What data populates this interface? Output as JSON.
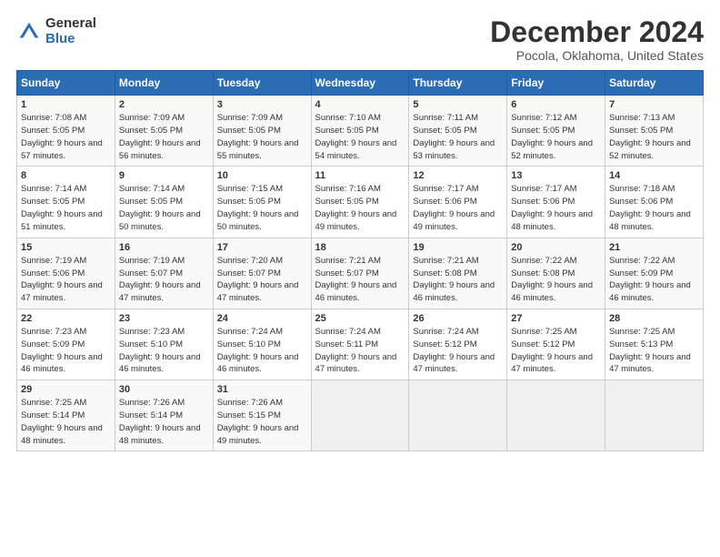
{
  "header": {
    "logo_general": "General",
    "logo_blue": "Blue",
    "title": "December 2024",
    "subtitle": "Pocola, Oklahoma, United States"
  },
  "days_of_week": [
    "Sunday",
    "Monday",
    "Tuesday",
    "Wednesday",
    "Thursday",
    "Friday",
    "Saturday"
  ],
  "weeks": [
    [
      {
        "day": "1",
        "sunrise": "Sunrise: 7:08 AM",
        "sunset": "Sunset: 5:05 PM",
        "daylight": "Daylight: 9 hours and 57 minutes."
      },
      {
        "day": "2",
        "sunrise": "Sunrise: 7:09 AM",
        "sunset": "Sunset: 5:05 PM",
        "daylight": "Daylight: 9 hours and 56 minutes."
      },
      {
        "day": "3",
        "sunrise": "Sunrise: 7:09 AM",
        "sunset": "Sunset: 5:05 PM",
        "daylight": "Daylight: 9 hours and 55 minutes."
      },
      {
        "day": "4",
        "sunrise": "Sunrise: 7:10 AM",
        "sunset": "Sunset: 5:05 PM",
        "daylight": "Daylight: 9 hours and 54 minutes."
      },
      {
        "day": "5",
        "sunrise": "Sunrise: 7:11 AM",
        "sunset": "Sunset: 5:05 PM",
        "daylight": "Daylight: 9 hours and 53 minutes."
      },
      {
        "day": "6",
        "sunrise": "Sunrise: 7:12 AM",
        "sunset": "Sunset: 5:05 PM",
        "daylight": "Daylight: 9 hours and 52 minutes."
      },
      {
        "day": "7",
        "sunrise": "Sunrise: 7:13 AM",
        "sunset": "Sunset: 5:05 PM",
        "daylight": "Daylight: 9 hours and 52 minutes."
      }
    ],
    [
      {
        "day": "8",
        "sunrise": "Sunrise: 7:14 AM",
        "sunset": "Sunset: 5:05 PM",
        "daylight": "Daylight: 9 hours and 51 minutes."
      },
      {
        "day": "9",
        "sunrise": "Sunrise: 7:14 AM",
        "sunset": "Sunset: 5:05 PM",
        "daylight": "Daylight: 9 hours and 50 minutes."
      },
      {
        "day": "10",
        "sunrise": "Sunrise: 7:15 AM",
        "sunset": "Sunset: 5:05 PM",
        "daylight": "Daylight: 9 hours and 50 minutes."
      },
      {
        "day": "11",
        "sunrise": "Sunrise: 7:16 AM",
        "sunset": "Sunset: 5:05 PM",
        "daylight": "Daylight: 9 hours and 49 minutes."
      },
      {
        "day": "12",
        "sunrise": "Sunrise: 7:17 AM",
        "sunset": "Sunset: 5:06 PM",
        "daylight": "Daylight: 9 hours and 49 minutes."
      },
      {
        "day": "13",
        "sunrise": "Sunrise: 7:17 AM",
        "sunset": "Sunset: 5:06 PM",
        "daylight": "Daylight: 9 hours and 48 minutes."
      },
      {
        "day": "14",
        "sunrise": "Sunrise: 7:18 AM",
        "sunset": "Sunset: 5:06 PM",
        "daylight": "Daylight: 9 hours and 48 minutes."
      }
    ],
    [
      {
        "day": "15",
        "sunrise": "Sunrise: 7:19 AM",
        "sunset": "Sunset: 5:06 PM",
        "daylight": "Daylight: 9 hours and 47 minutes."
      },
      {
        "day": "16",
        "sunrise": "Sunrise: 7:19 AM",
        "sunset": "Sunset: 5:07 PM",
        "daylight": "Daylight: 9 hours and 47 minutes."
      },
      {
        "day": "17",
        "sunrise": "Sunrise: 7:20 AM",
        "sunset": "Sunset: 5:07 PM",
        "daylight": "Daylight: 9 hours and 47 minutes."
      },
      {
        "day": "18",
        "sunrise": "Sunrise: 7:21 AM",
        "sunset": "Sunset: 5:07 PM",
        "daylight": "Daylight: 9 hours and 46 minutes."
      },
      {
        "day": "19",
        "sunrise": "Sunrise: 7:21 AM",
        "sunset": "Sunset: 5:08 PM",
        "daylight": "Daylight: 9 hours and 46 minutes."
      },
      {
        "day": "20",
        "sunrise": "Sunrise: 7:22 AM",
        "sunset": "Sunset: 5:08 PM",
        "daylight": "Daylight: 9 hours and 46 minutes."
      },
      {
        "day": "21",
        "sunrise": "Sunrise: 7:22 AM",
        "sunset": "Sunset: 5:09 PM",
        "daylight": "Daylight: 9 hours and 46 minutes."
      }
    ],
    [
      {
        "day": "22",
        "sunrise": "Sunrise: 7:23 AM",
        "sunset": "Sunset: 5:09 PM",
        "daylight": "Daylight: 9 hours and 46 minutes."
      },
      {
        "day": "23",
        "sunrise": "Sunrise: 7:23 AM",
        "sunset": "Sunset: 5:10 PM",
        "daylight": "Daylight: 9 hours and 46 minutes."
      },
      {
        "day": "24",
        "sunrise": "Sunrise: 7:24 AM",
        "sunset": "Sunset: 5:10 PM",
        "daylight": "Daylight: 9 hours and 46 minutes."
      },
      {
        "day": "25",
        "sunrise": "Sunrise: 7:24 AM",
        "sunset": "Sunset: 5:11 PM",
        "daylight": "Daylight: 9 hours and 47 minutes."
      },
      {
        "day": "26",
        "sunrise": "Sunrise: 7:24 AM",
        "sunset": "Sunset: 5:12 PM",
        "daylight": "Daylight: 9 hours and 47 minutes."
      },
      {
        "day": "27",
        "sunrise": "Sunrise: 7:25 AM",
        "sunset": "Sunset: 5:12 PM",
        "daylight": "Daylight: 9 hours and 47 minutes."
      },
      {
        "day": "28",
        "sunrise": "Sunrise: 7:25 AM",
        "sunset": "Sunset: 5:13 PM",
        "daylight": "Daylight: 9 hours and 47 minutes."
      }
    ],
    [
      {
        "day": "29",
        "sunrise": "Sunrise: 7:25 AM",
        "sunset": "Sunset: 5:14 PM",
        "daylight": "Daylight: 9 hours and 48 minutes."
      },
      {
        "day": "30",
        "sunrise": "Sunrise: 7:26 AM",
        "sunset": "Sunset: 5:14 PM",
        "daylight": "Daylight: 9 hours and 48 minutes."
      },
      {
        "day": "31",
        "sunrise": "Sunrise: 7:26 AM",
        "sunset": "Sunset: 5:15 PM",
        "daylight": "Daylight: 9 hours and 49 minutes."
      },
      null,
      null,
      null,
      null
    ]
  ]
}
